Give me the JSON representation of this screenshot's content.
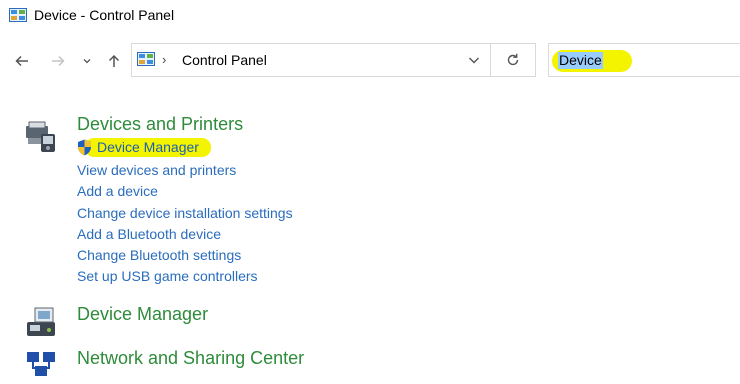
{
  "window": {
    "title": "Device - Control Panel"
  },
  "address_bar": {
    "breadcrumb": "Control Panel",
    "separator": "›",
    "search_value": "Device"
  },
  "results": {
    "devices_printers": {
      "heading": "Devices and Printers",
      "links": [
        "Device Manager",
        "View devices and printers",
        "Add a device",
        "Change device installation settings",
        "Add a Bluetooth device",
        "Change Bluetooth settings",
        "Set up USB game controllers"
      ]
    },
    "device_manager": {
      "heading": "Device Manager"
    },
    "network_sharing": {
      "heading": "Network and Sharing Center"
    }
  },
  "colors": {
    "heading_green": "#2e8b3a",
    "link_blue": "#2a6dbd",
    "highlight_yellow": "#f4f400",
    "selection_blue": "#98ccff"
  },
  "icons": {
    "title": "control-panel-icon",
    "back": "arrow-left-icon",
    "forward": "arrow-right-icon",
    "recent": "chevron-down-icon",
    "up": "arrow-up-icon",
    "address": "control-panel-icon",
    "dropdown": "chevron-down-icon",
    "refresh": "refresh-icon",
    "devices_printers": "printer-device-icon",
    "uac": "uac-shield-icon",
    "device_manager": "device-manager-icon",
    "network": "network-icon"
  }
}
